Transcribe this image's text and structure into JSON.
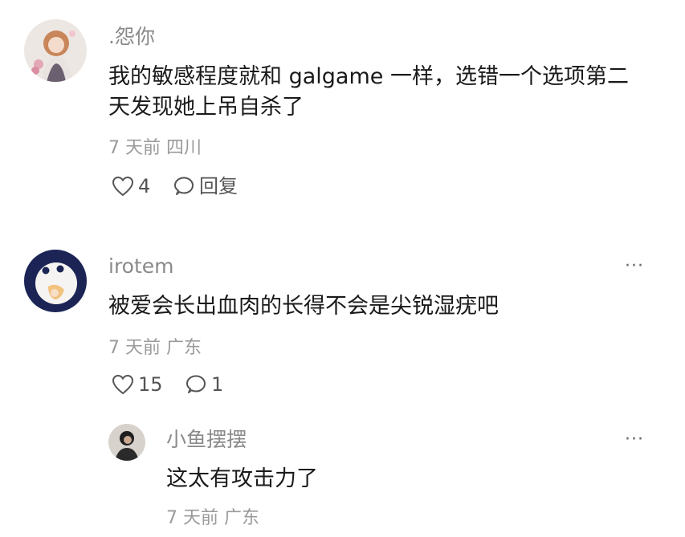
{
  "comments": [
    {
      "username": ".怨你",
      "content_line1": "我的敏感程度就和 galgame 一样，选错一个选项第二",
      "content_line2": "天发现她上吊自杀了",
      "time": "7 天前",
      "location": "四川",
      "likes": "4",
      "reply_label": "回复"
    },
    {
      "username": "irotem",
      "content": "被爱会长出血肉的长得不会是尖锐湿疣吧",
      "time": "7 天前",
      "location": "广东",
      "likes": "15",
      "replies": "1",
      "more": "···"
    }
  ],
  "reply": {
    "username": "小鱼摆摆",
    "content": "这太有攻击力了",
    "time": "7 天前",
    "location": "广东",
    "more": "···"
  },
  "colors": {
    "username": "#8a8a8a",
    "content": "#1a1a1a",
    "meta": "#9a9a9a",
    "action": "#555555"
  }
}
